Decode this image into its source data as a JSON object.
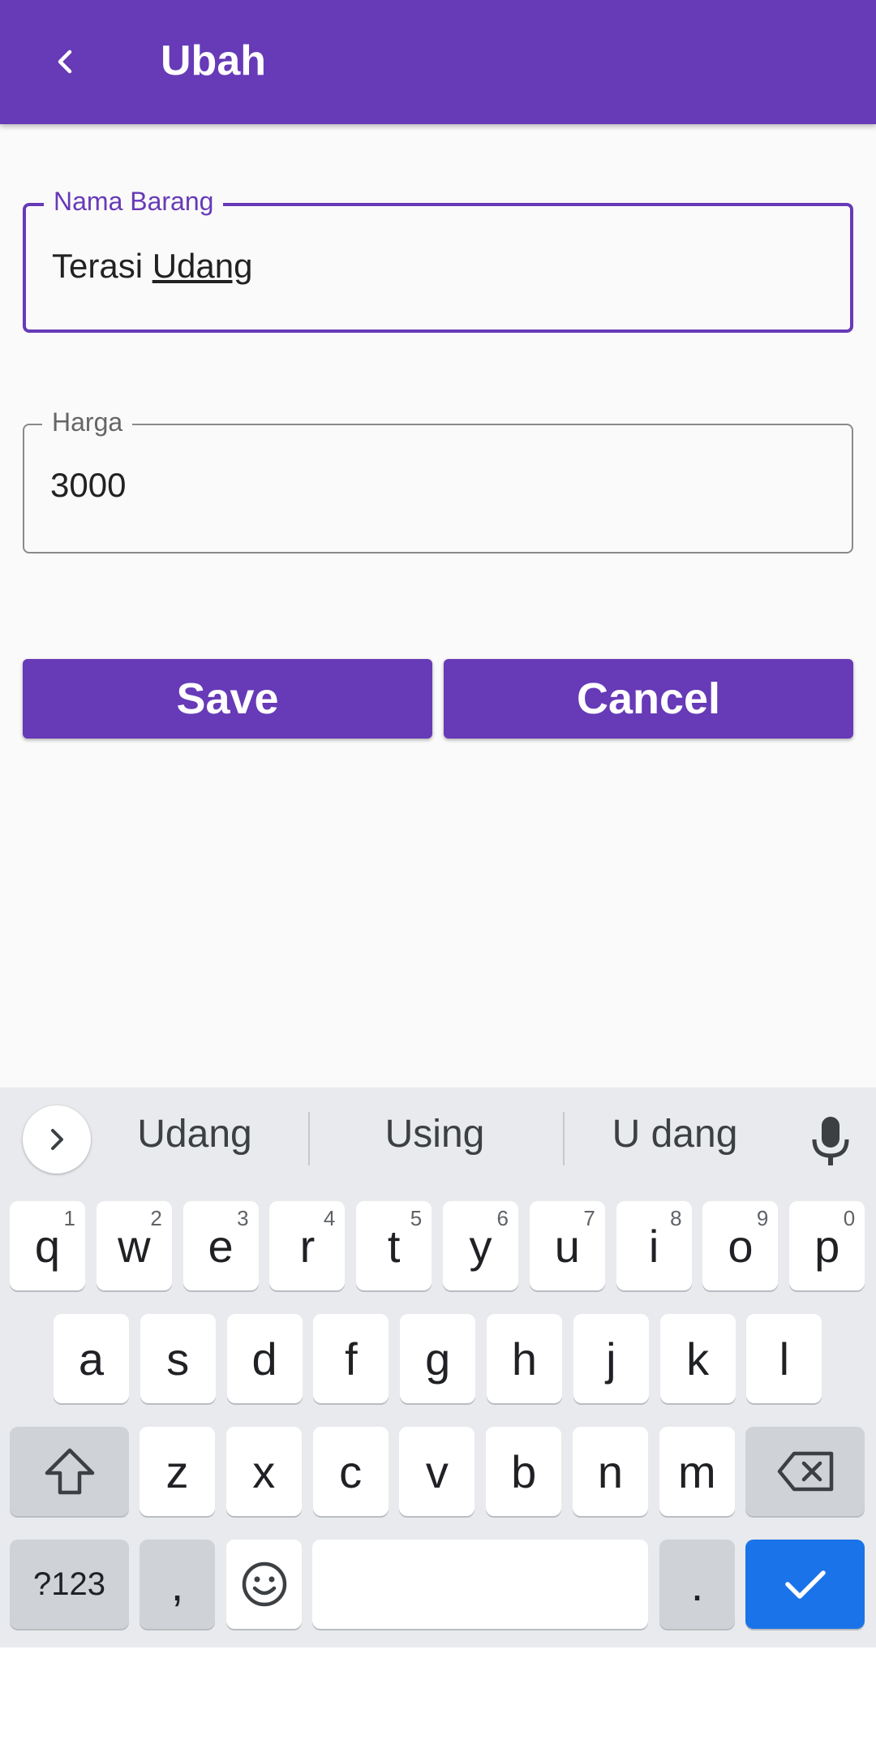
{
  "appbar": {
    "title": "Ubah"
  },
  "form": {
    "name": {
      "label": "Nama Barang",
      "value_prefix": "Terasi ",
      "value_composing": "Udang"
    },
    "price": {
      "label": "Harga",
      "value": "3000"
    }
  },
  "buttons": {
    "save": "Save",
    "cancel": "Cancel"
  },
  "keyboard": {
    "suggestions": [
      "Udang",
      "Using",
      "U dang"
    ],
    "row1": [
      {
        "k": "q",
        "s": "1"
      },
      {
        "k": "w",
        "s": "2"
      },
      {
        "k": "e",
        "s": "3"
      },
      {
        "k": "r",
        "s": "4"
      },
      {
        "k": "t",
        "s": "5"
      },
      {
        "k": "y",
        "s": "6"
      },
      {
        "k": "u",
        "s": "7"
      },
      {
        "k": "i",
        "s": "8"
      },
      {
        "k": "o",
        "s": "9"
      },
      {
        "k": "p",
        "s": "0"
      }
    ],
    "row2": [
      "a",
      "s",
      "d",
      "f",
      "g",
      "h",
      "j",
      "k",
      "l"
    ],
    "row3": [
      "z",
      "x",
      "c",
      "v",
      "b",
      "n",
      "m"
    ],
    "symbols_label": "?123",
    "comma": ",",
    "period": "."
  },
  "colors": {
    "primary": "#673ab7",
    "enter": "#1a73e8"
  }
}
